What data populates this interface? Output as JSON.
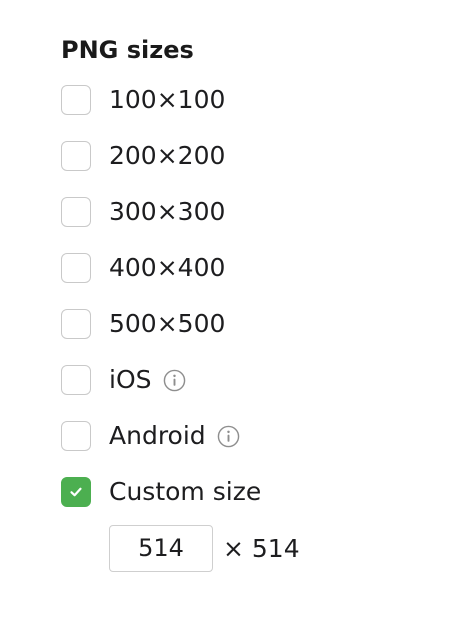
{
  "section": {
    "title": "PNG sizes"
  },
  "options": [
    {
      "label": "100×100",
      "checked": false,
      "info": false
    },
    {
      "label": "200×200",
      "checked": false,
      "info": false
    },
    {
      "label": "300×300",
      "checked": false,
      "info": false
    },
    {
      "label": "400×400",
      "checked": false,
      "info": false
    },
    {
      "label": "500×500",
      "checked": false,
      "info": false
    },
    {
      "label": "iOS",
      "checked": false,
      "info": true
    },
    {
      "label": "Android",
      "checked": false,
      "info": true
    },
    {
      "label": "Custom size",
      "checked": true,
      "info": false
    }
  ],
  "custom": {
    "width_value": "514",
    "height_text": "× 514"
  },
  "icons": {
    "checkmark": "checkmark-icon",
    "info": "info-icon"
  },
  "colors": {
    "accent": "#4caf50",
    "checkbox_border": "#c9c9c9",
    "text": "#1d1d1f",
    "info_icon": "#8e8e8e"
  }
}
